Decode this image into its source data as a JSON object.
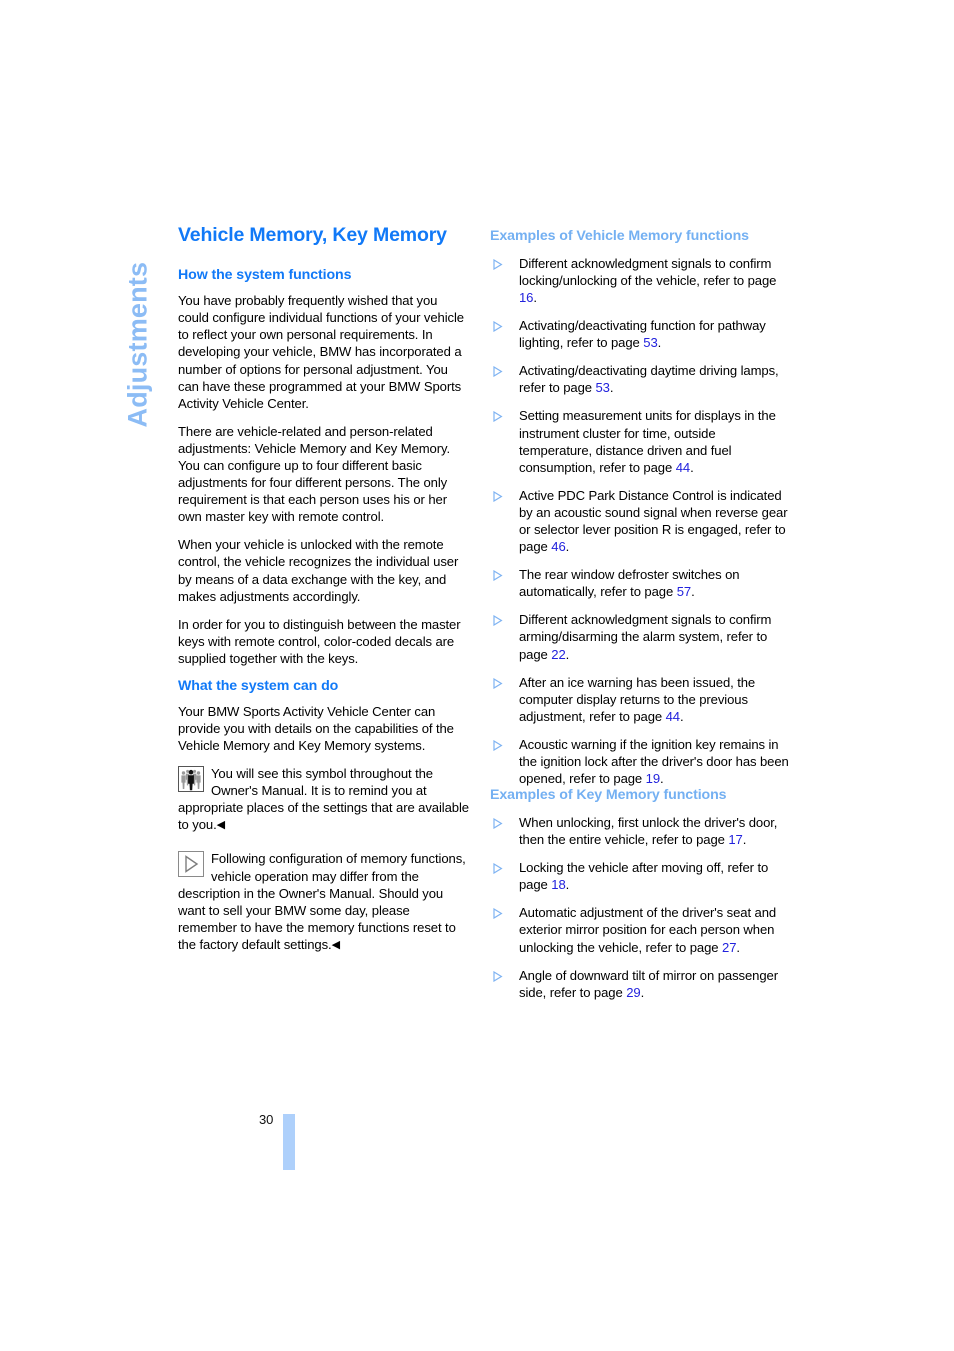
{
  "page": {
    "chapter_tab": "Adjustments",
    "folio": "30",
    "colors": {
      "title_blue": "#1179f7",
      "subhead_blue": "#74b0f2",
      "tab_blue": "#8cbcf5",
      "page_ref_blue": "#2222dd",
      "folio_bar": "#aed0fb"
    }
  },
  "left_column": {
    "title": "Vehicle Memory, Key Memory",
    "section1": {
      "heading": "How the system functions",
      "paragraphs": [
        "You have probably frequently wished that you could configure individual functions of your vehicle to reflect your own personal requirements. In developing your vehicle, BMW has incorporated a number of options for personal adjustment. You can have these programmed at your BMW Sports Activity Vehicle Center.",
        "There are vehicle-related and person-related adjustments: Vehicle Memory and Key Memory. You can configure up to four different basic adjustments for four different persons. The only requirement is that each person uses his or her own master key with remote control.",
        "When your vehicle is unlocked with the remote control, the vehicle recognizes the individual user by means of a data exchange with the key, and makes adjustments accordingly.",
        "In order for you to distinguish between the master keys with remote control, color-coded decals are supplied together with the keys."
      ]
    },
    "section2": {
      "heading": "What the system can do",
      "paragraph": "Your BMW Sports Activity Vehicle Center can provide you with details on the capabilities of the Vehicle Memory and Key Memory systems.",
      "note_people": {
        "icon": "people-group-icon",
        "text": "You will see this symbol throughout the Owner's Manual. It is to remind you at appropriate places of the settings that are available to you.",
        "endmark": "◀"
      },
      "note_triangle": {
        "icon": "triangle-right-boxed-icon",
        "text": "Following configuration of memory functions, vehicle operation may differ from the description in the Owner's Manual. Should you want to sell your BMW some day, please remember to have the memory functions reset to the factory default settings.",
        "endmark": "◀"
      }
    }
  },
  "right_column": {
    "section_vehicle_memory": {
      "heading": "Examples of Vehicle Memory functions",
      "items": [
        {
          "text_before": "Different acknowledgment signals to confirm locking/unlocking of the vehicle, refer to page ",
          "page_ref": "16",
          "text_after": "."
        },
        {
          "text_before": "Activating/deactivating function for pathway lighting, refer to page ",
          "page_ref": "53",
          "text_after": "."
        },
        {
          "text_before": "Activating/deactivating daytime driving lamps, refer to page ",
          "page_ref": "53",
          "text_after": "."
        },
        {
          "text_before": "Setting measurement units for displays in the instrument cluster for time, outside temperature, distance driven and fuel consumption, refer to page ",
          "page_ref": "44",
          "text_after": "."
        },
        {
          "text_before": "Active PDC Park Distance Control is indicated by an acoustic sound signal when reverse gear or selector lever position R is engaged, refer to page ",
          "page_ref": "46",
          "text_after": "."
        },
        {
          "text_before": "The rear window defroster switches on automatically, refer to page ",
          "page_ref": "57",
          "text_after": "."
        },
        {
          "text_before": "Different acknowledgment signals to confirm arming/disarming the alarm system, refer to page ",
          "page_ref": "22",
          "text_after": "."
        },
        {
          "text_before": "After an ice warning has been issued, the computer display returns to the previous adjustment, refer to page ",
          "page_ref": "44",
          "text_after": "."
        },
        {
          "text_before": "Acoustic warning if the ignition key remains in the ignition lock after the driver's door has been opened, refer to page ",
          "page_ref": "19",
          "text_after": "."
        }
      ]
    },
    "section_key_memory": {
      "heading": "Examples of Key Memory functions",
      "items": [
        {
          "text_before": "When unlocking, first unlock the driver's door, then the entire vehicle, refer to page ",
          "page_ref": "17",
          "text_after": "."
        },
        {
          "text_before": "Locking the vehicle after moving off, refer to page ",
          "page_ref": "18",
          "text_after": "."
        },
        {
          "text_before": "Automatic adjustment of the driver's seat and exterior mirror position for each person when unlocking the vehicle, refer to page ",
          "page_ref": "27",
          "text_after": "."
        },
        {
          "text_before": "Angle of downward tilt of mirror on passenger side, refer to page ",
          "page_ref": "29",
          "text_after": "."
        }
      ]
    }
  }
}
